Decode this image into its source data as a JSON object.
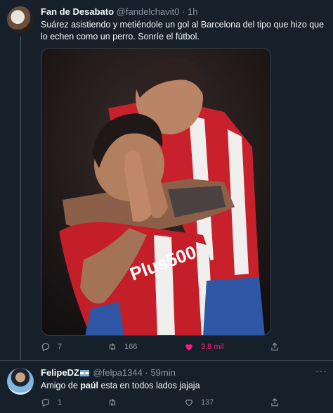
{
  "tweet1": {
    "display_name": "Fan de Desabato",
    "handle": "@fandelchavit0",
    "separator": "·",
    "time": "1h",
    "text": "Suárez asistiendo y metiéndole un gol al Barcelona del tipo que hizo que lo echen como un perro. Sonríe el fútbol.",
    "media_alt": "Luis Suárez celebrating with Atlético Madrid teammate",
    "stats": {
      "replies": "7",
      "retweets": "166",
      "likes": "3,8 mil"
    },
    "liked": true
  },
  "tweet2": {
    "display_name": "FelipeDZ",
    "handle": "@felpa1344",
    "separator": "·",
    "time": "59min",
    "text_before": "Amigo de ",
    "text_bold": "paúl",
    "text_after": " esta en todos lados jajaja",
    "stats": {
      "replies": "1",
      "retweets": "",
      "likes": "137"
    }
  },
  "colors": {
    "background": "#15202b",
    "border": "#38444d",
    "muted": "#8b98a5",
    "like": "#f91880",
    "text": "#f7f9f9"
  },
  "icons": {
    "reply": "reply-icon",
    "retweet": "retweet-icon",
    "like": "heart-icon",
    "share": "share-icon",
    "more": "more-icon"
  }
}
